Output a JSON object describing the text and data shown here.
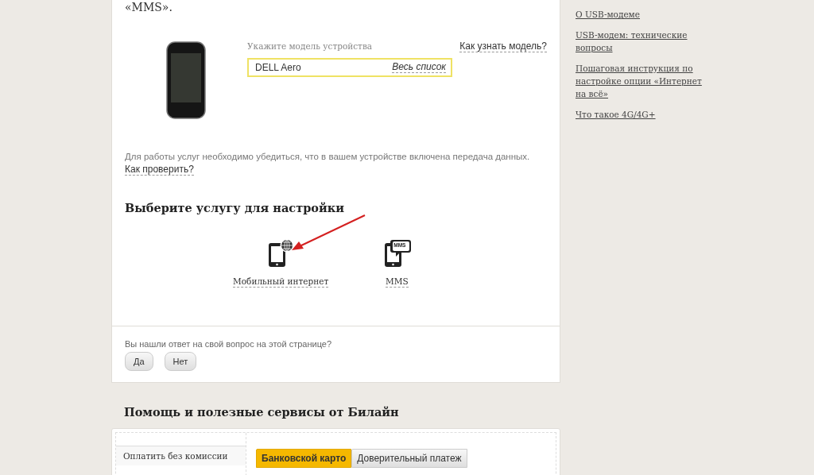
{
  "intro_tail": "«MMS».",
  "device": {
    "label": "Укажите модель устройства",
    "help_link": "Как узнать модель?",
    "value": "DELL Aero",
    "list_link": "Весь список"
  },
  "data_note": {
    "text": "Для работы услуг необходимо убедиться, что в вашем устройстве включена передача данных.",
    "link": "Как проверить?"
  },
  "services": {
    "title": "Выберите услугу для настройки",
    "items": [
      {
        "kind": "internet",
        "label": "Мобильный интернет"
      },
      {
        "kind": "mms",
        "label": "MMS",
        "badge": "MMS"
      }
    ]
  },
  "feedback": {
    "question": "Вы нашли ответ на свой вопрос на этой странице?",
    "buttons": [
      "Да",
      "Нет"
    ]
  },
  "sidebar": {
    "links": [
      "О USB-модеме",
      "USB-модем: технические вопросы",
      "Пошаговая инструкция по настройке опции «Интернет на всё»",
      "Что такое 4G/4G+"
    ]
  },
  "help": {
    "title": "Помощь и полезные сервисы от Билайн",
    "menu": [
      "Оплатить без комиссии"
    ],
    "tabs": [
      {
        "label": "Банковской карто",
        "selected": true
      },
      {
        "label": "Доверительный платеж",
        "selected": false
      }
    ]
  }
}
